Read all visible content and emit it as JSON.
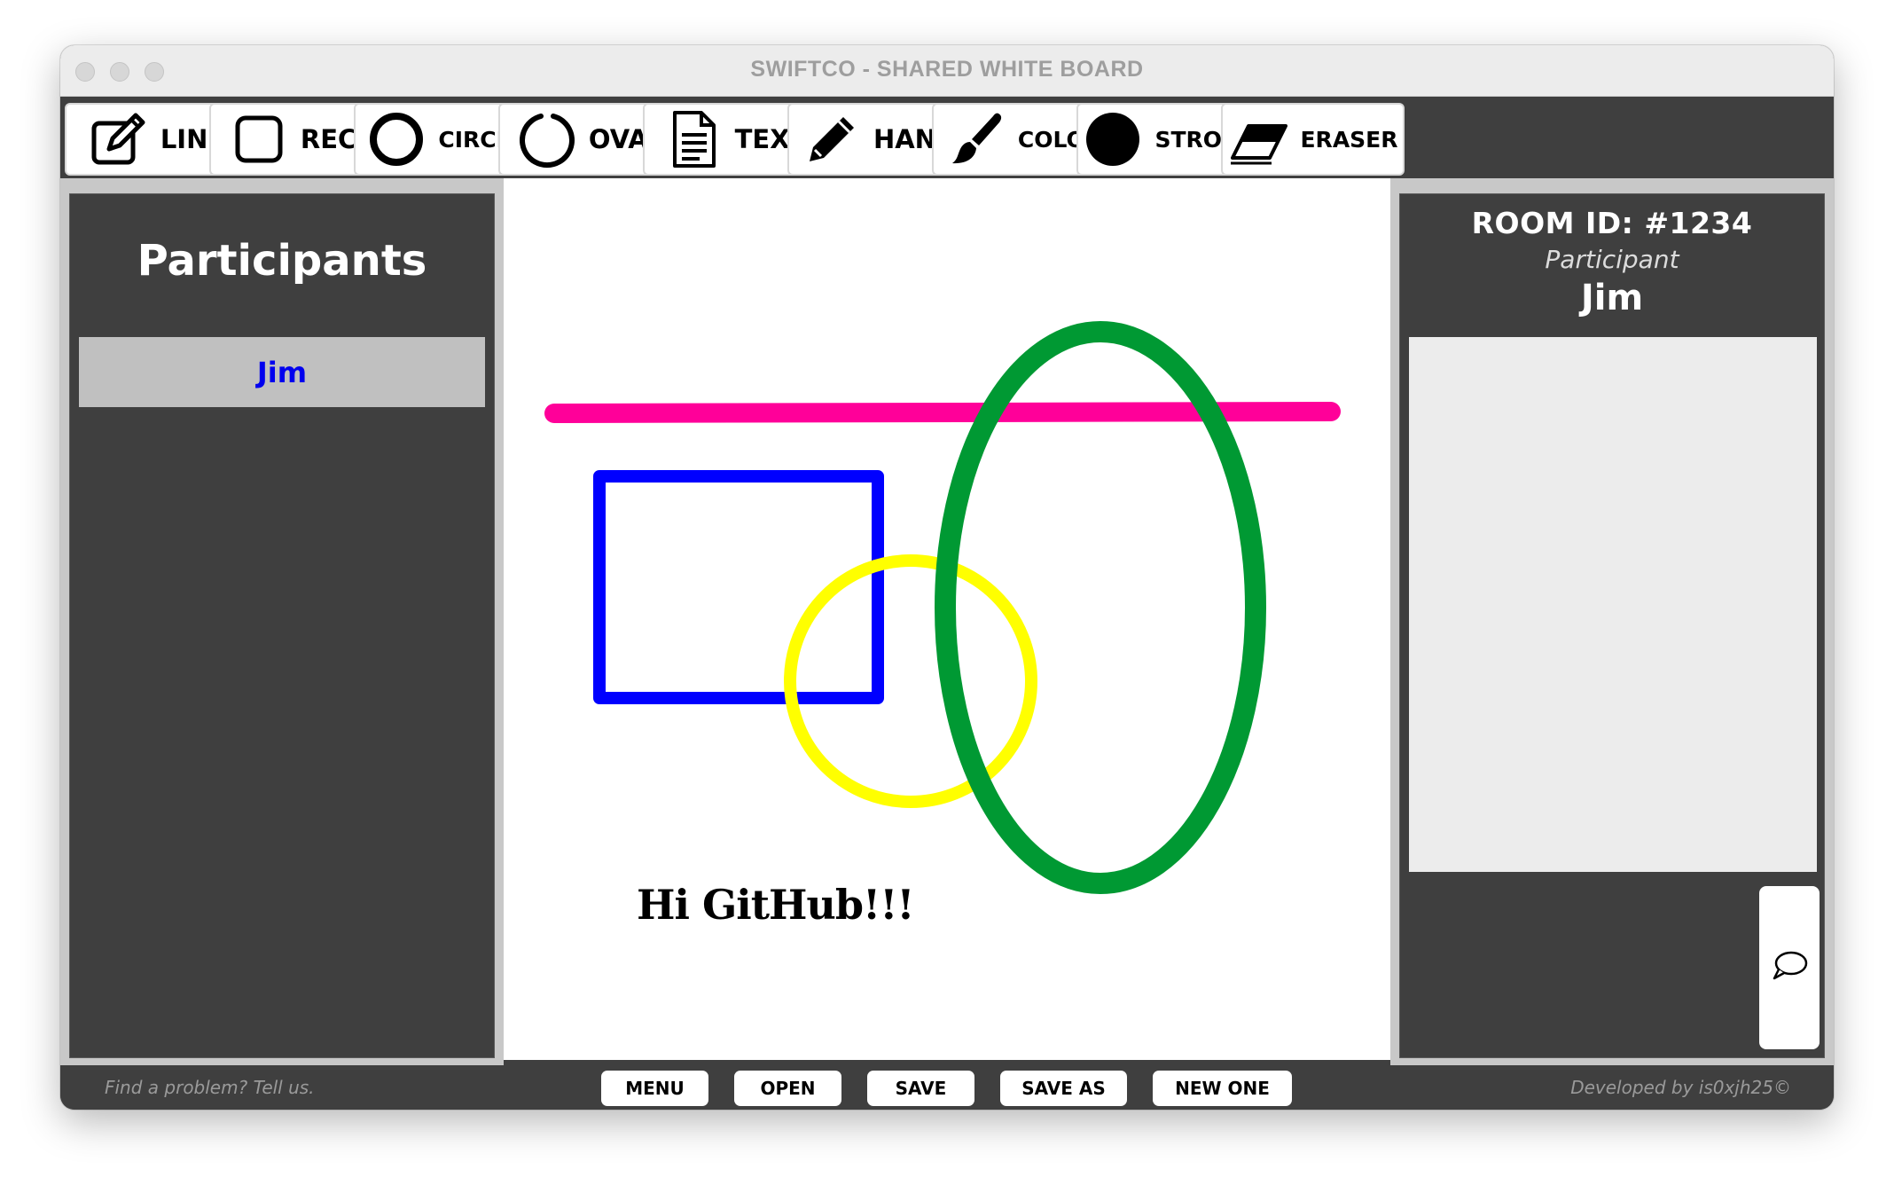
{
  "window": {
    "title": "SWIFTCO - SHARED WHITE BOARD"
  },
  "toolbar": {
    "tools": [
      {
        "label": "LINE",
        "icon": "pencil-square-icon"
      },
      {
        "label": "RECT",
        "icon": "square-outline-icon"
      },
      {
        "label": "CIRCLE",
        "icon": "circle-outline-icon"
      },
      {
        "label": "OVAL",
        "icon": "oval-outline-icon"
      },
      {
        "label": "TEXT",
        "icon": "document-text-icon"
      },
      {
        "label": "HAND",
        "icon": "pencil-icon"
      },
      {
        "label": "COLOR",
        "icon": "paintbrush-icon"
      },
      {
        "label": "STROKE",
        "icon": "filled-circle-icon"
      },
      {
        "label": "ERASER",
        "icon": "eraser-icon"
      }
    ]
  },
  "participants_panel": {
    "title": "Participants",
    "items": [
      {
        "name": "Jim"
      }
    ]
  },
  "room_panel": {
    "room_id": "ROOM ID: #1234",
    "role": "Participant",
    "user_name": "Jim",
    "chat_icon": "speech-bubble-icon"
  },
  "canvas": {
    "text": "Hi GitHub!!!",
    "colors": {
      "line": "#ff0099",
      "rect": "#0000ff",
      "circle": "#ffff00",
      "oval": "#009933",
      "text": "#000000"
    }
  },
  "footer": {
    "feedback": "Find a problem? Tell us.",
    "credit": "Developed by is0xjh25©",
    "buttons": [
      {
        "label": "MENU"
      },
      {
        "label": "OPEN"
      },
      {
        "label": "SAVE"
      },
      {
        "label": "SAVE AS"
      },
      {
        "label": "NEW ONE"
      }
    ]
  }
}
